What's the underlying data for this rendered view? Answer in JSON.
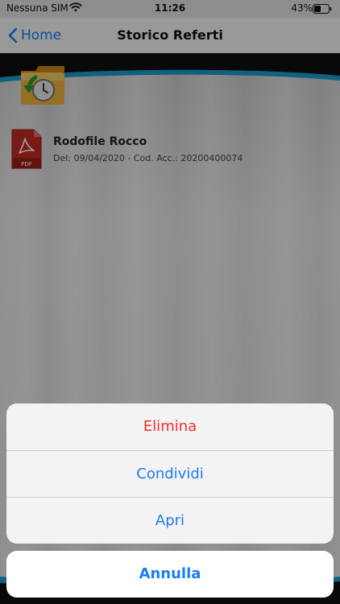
{
  "status_bar": {
    "carrier": "Nessuna SIM",
    "time": "11:26",
    "battery": "43%"
  },
  "nav": {
    "back_label": "Home",
    "title": "Storico Referti"
  },
  "report": {
    "name": "Rodofile Rocco",
    "details": "Del: 09/04/2020 - Cod. Acc.: 20200400074",
    "icon_label": "PDF"
  },
  "action_sheet": {
    "items": [
      {
        "label": "Elimina",
        "style": "destructive"
      },
      {
        "label": "Condividi",
        "style": "default"
      },
      {
        "label": "Apri",
        "style": "default"
      }
    ],
    "cancel_label": "Annulla"
  },
  "colors": {
    "accent": "#1a7ef0",
    "destructive": "#f0302a",
    "band_blue": "#1e9bd0"
  },
  "icons": {
    "wifi": "wifi-icon",
    "battery": "battery-icon",
    "back": "chevron-left-icon",
    "history_folder": "history-folder-icon",
    "pdf": "pdf-file-icon"
  }
}
